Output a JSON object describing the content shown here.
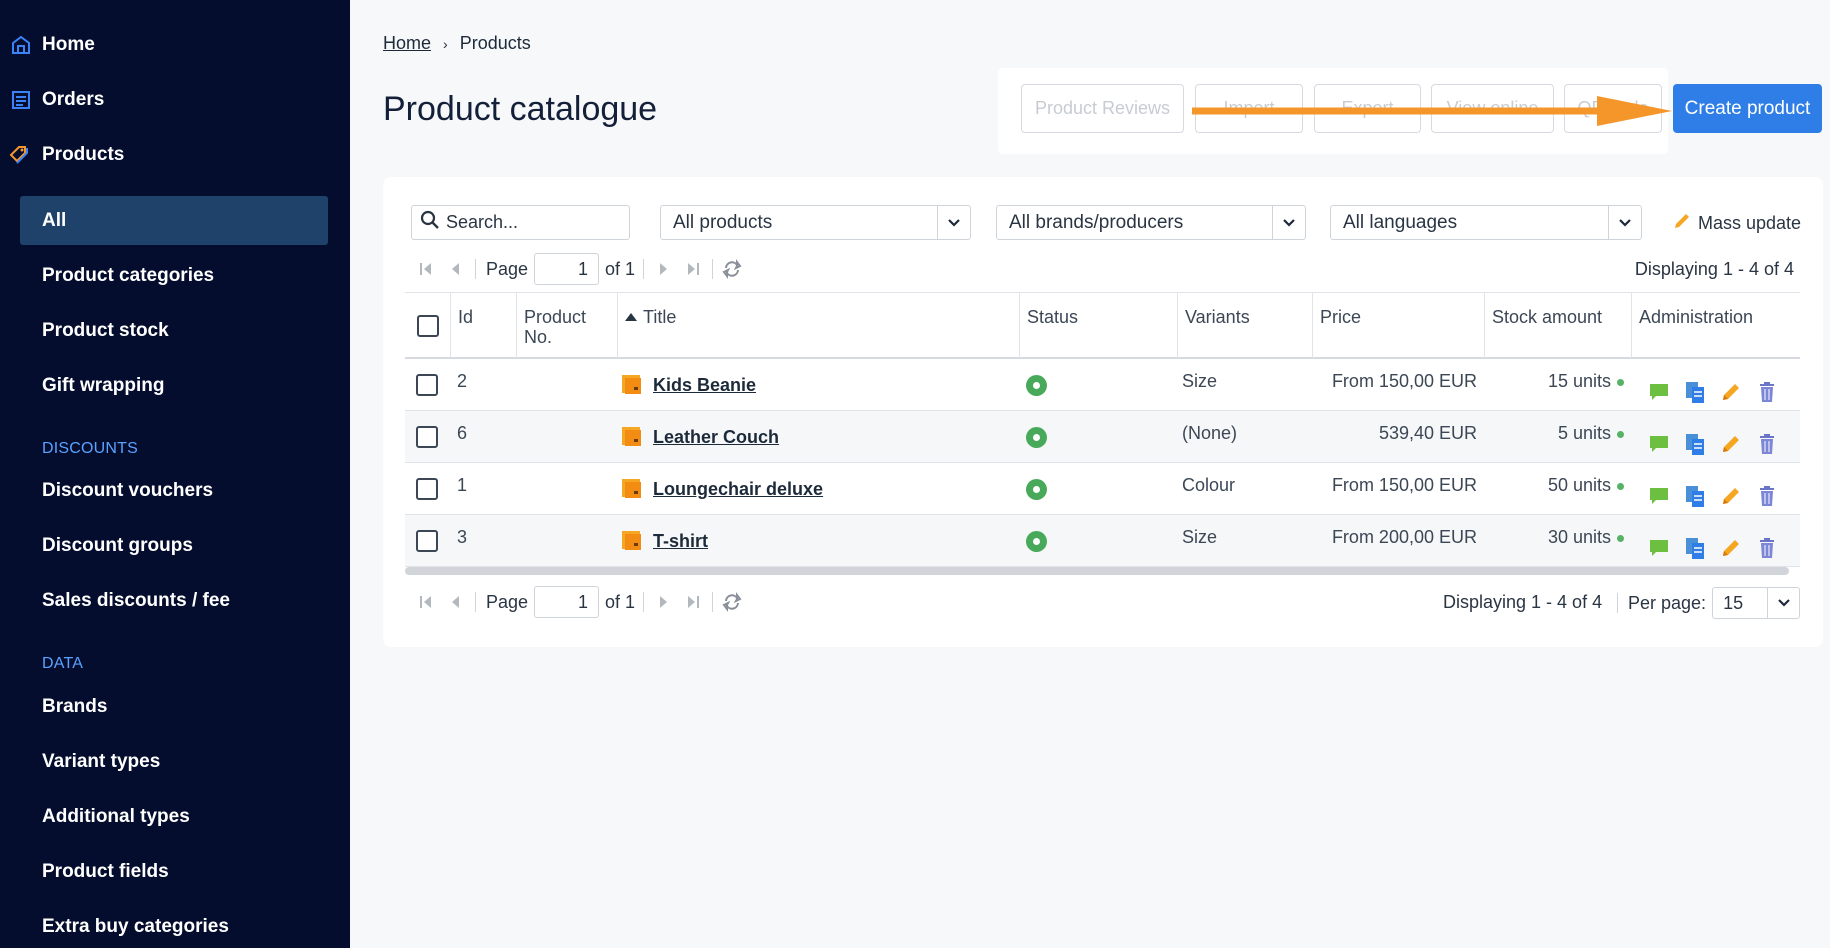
{
  "sidebar": {
    "top_items": [
      {
        "label": "Home",
        "icon": "home-icon"
      },
      {
        "label": "Orders",
        "icon": "orders-icon"
      },
      {
        "label": "Products",
        "icon": "tag-icon"
      }
    ],
    "product_items": [
      {
        "label": "All",
        "active": true
      },
      {
        "label": "Product categories"
      },
      {
        "label": "Product stock"
      },
      {
        "label": "Gift wrapping"
      }
    ],
    "discounts_heading": "DISCOUNTS",
    "discount_items": [
      {
        "label": "Discount vouchers"
      },
      {
        "label": "Discount groups"
      },
      {
        "label": "Sales discounts / fee"
      }
    ],
    "data_heading": "DATA",
    "data_items": [
      {
        "label": "Brands"
      },
      {
        "label": "Variant types"
      },
      {
        "label": "Additional types"
      },
      {
        "label": "Product fields"
      },
      {
        "label": "Extra buy categories"
      }
    ]
  },
  "breadcrumb": {
    "home": "Home",
    "current": "Products"
  },
  "page_title": "Product catalogue",
  "toolbar": {
    "product_reviews": "Product Reviews",
    "import": "Import",
    "export": "Export",
    "view_online": "View online",
    "qr": "QR code",
    "create_product": "Create product"
  },
  "filters": {
    "search_placeholder": "Search...",
    "products": "All products",
    "brands": "All brands/producers",
    "languages": "All languages",
    "mass_update": "Mass update"
  },
  "pager": {
    "page_label": "Page",
    "page_value": "1",
    "of_label": "of 1",
    "displaying": "Displaying 1 - 4 of 4",
    "per_page_label": "Per page:",
    "per_page_value": "15"
  },
  "table": {
    "headers": {
      "id": "Id",
      "product_no": "Product No.",
      "title": "Title",
      "status": "Status",
      "variants": "Variants",
      "price": "Price",
      "stock": "Stock amount",
      "admin": "Administration"
    },
    "rows": [
      {
        "id": "2",
        "title": "Kids Beanie",
        "variants": "Size",
        "price": "From 150,00 EUR",
        "stock": "15 units"
      },
      {
        "id": "6",
        "title": "Leather Couch",
        "variants": "(None)",
        "price": "539,40 EUR",
        "stock": "5 units"
      },
      {
        "id": "1",
        "title": "Loungechair deluxe",
        "variants": "Colour",
        "price": "From 150,00 EUR",
        "stock": "50 units"
      },
      {
        "id": "3",
        "title": "T-shirt",
        "variants": "Size",
        "price": "From 200,00 EUR",
        "stock": "30 units"
      }
    ]
  },
  "colors": {
    "sidebar_bg": "#050d2e",
    "active_item": "#1f426b",
    "accent": "#2f7ee8",
    "arrow": "#f5962a",
    "status_green": "#48a95a"
  }
}
